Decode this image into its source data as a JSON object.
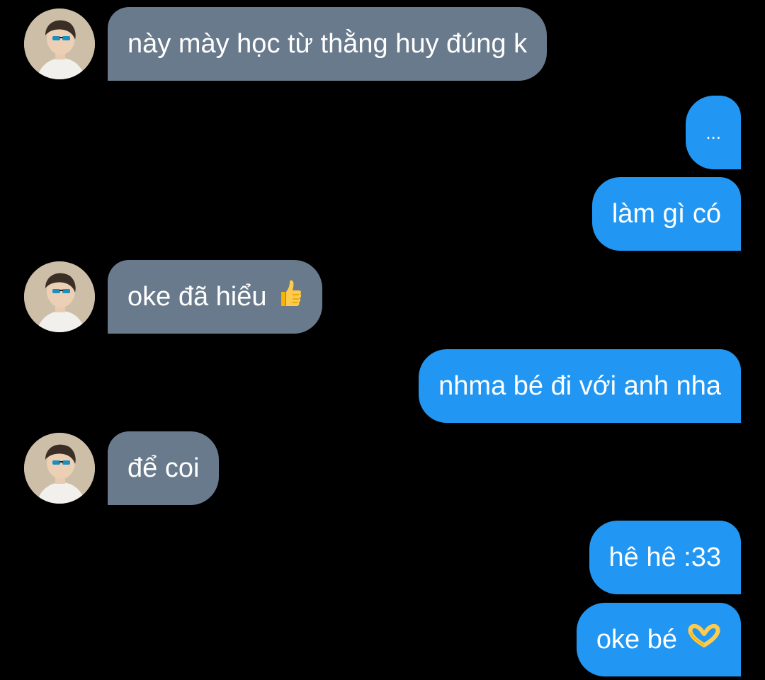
{
  "messages": [
    {
      "side": "incoming",
      "text": "này mày học từ thằng huy đúng k"
    },
    {
      "side": "outgoing",
      "text": "..."
    },
    {
      "side": "outgoing",
      "text": "làm gì có"
    },
    {
      "side": "incoming",
      "text": "oke đã hiểu",
      "emoji": "thumbs-up-icon"
    },
    {
      "side": "outgoing",
      "text": "nhma bé đi với anh nha"
    },
    {
      "side": "incoming",
      "text": "để coi"
    },
    {
      "side": "outgoing",
      "text": "hê hê :33"
    },
    {
      "side": "outgoing",
      "text": "oke bé",
      "emoji": "heart-hands-icon"
    }
  ],
  "colors": {
    "background": "#000000",
    "incoming_bubble": "#687a8b",
    "outgoing_bubble": "#2196f3",
    "text": "#ffffff"
  }
}
